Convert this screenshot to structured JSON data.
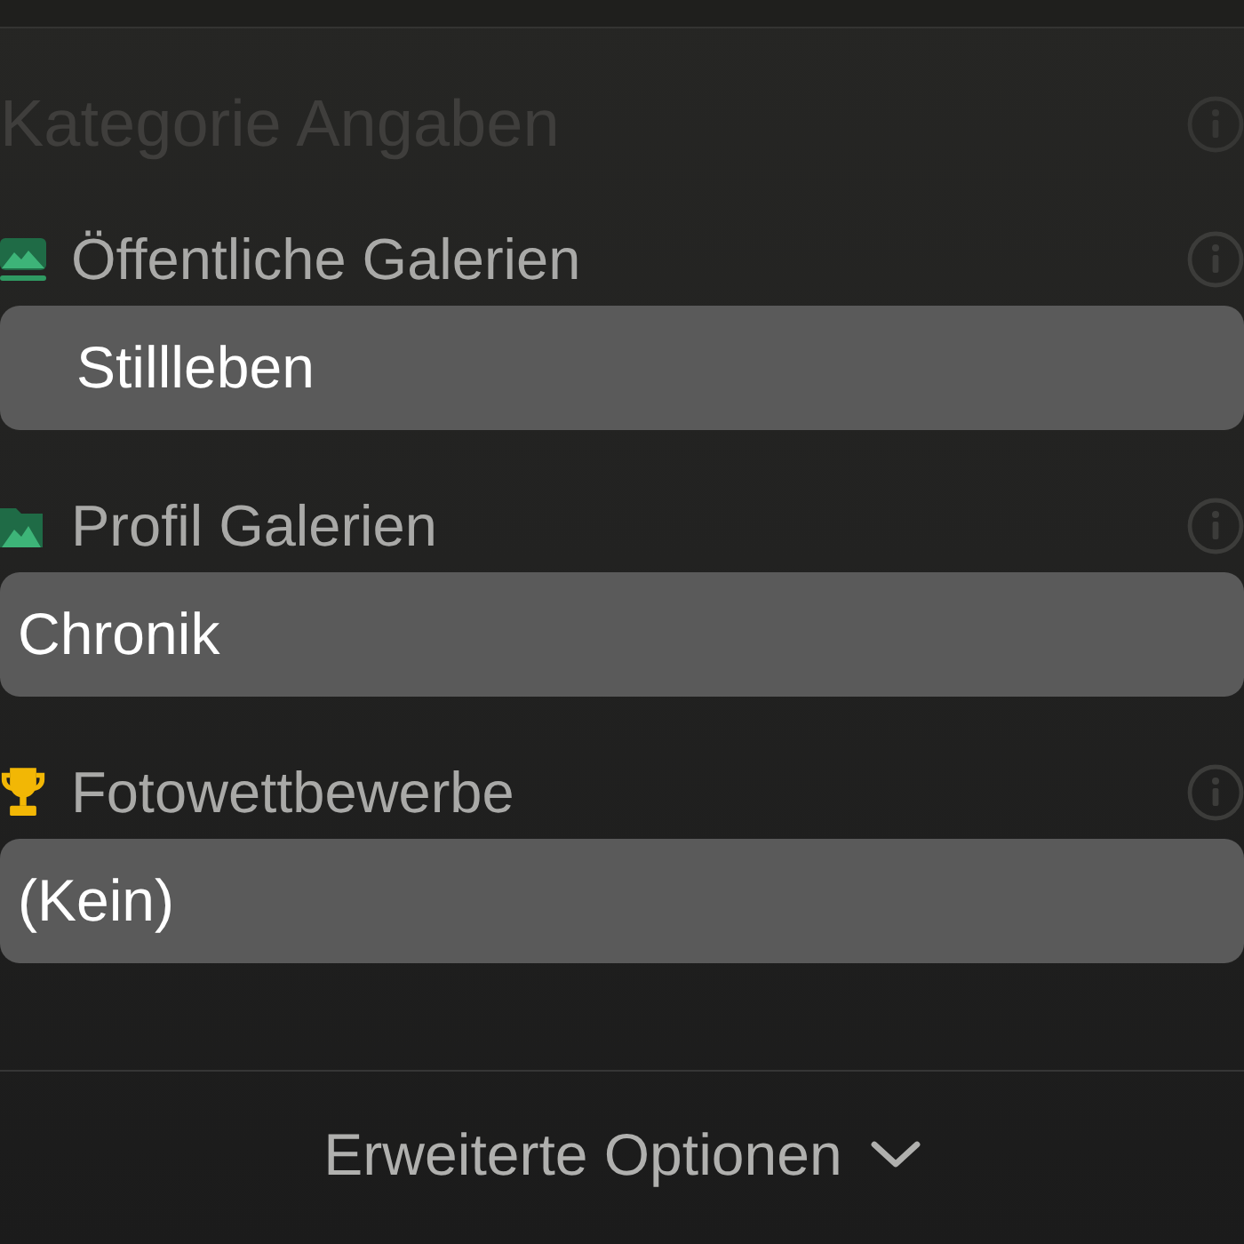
{
  "section": {
    "title": "Kategorie Angaben"
  },
  "fields": [
    {
      "kind": "gallery",
      "label": "Öffentliche Galerien",
      "value": "Stillleben"
    },
    {
      "kind": "folder",
      "label": "Profil Galerien",
      "value": "Chronik"
    },
    {
      "kind": "trophy",
      "label": "Fotowettbewerbe",
      "value": "(Kein)"
    }
  ],
  "advanced": {
    "label": "Erweiterte Optionen",
    "expanded": false
  }
}
